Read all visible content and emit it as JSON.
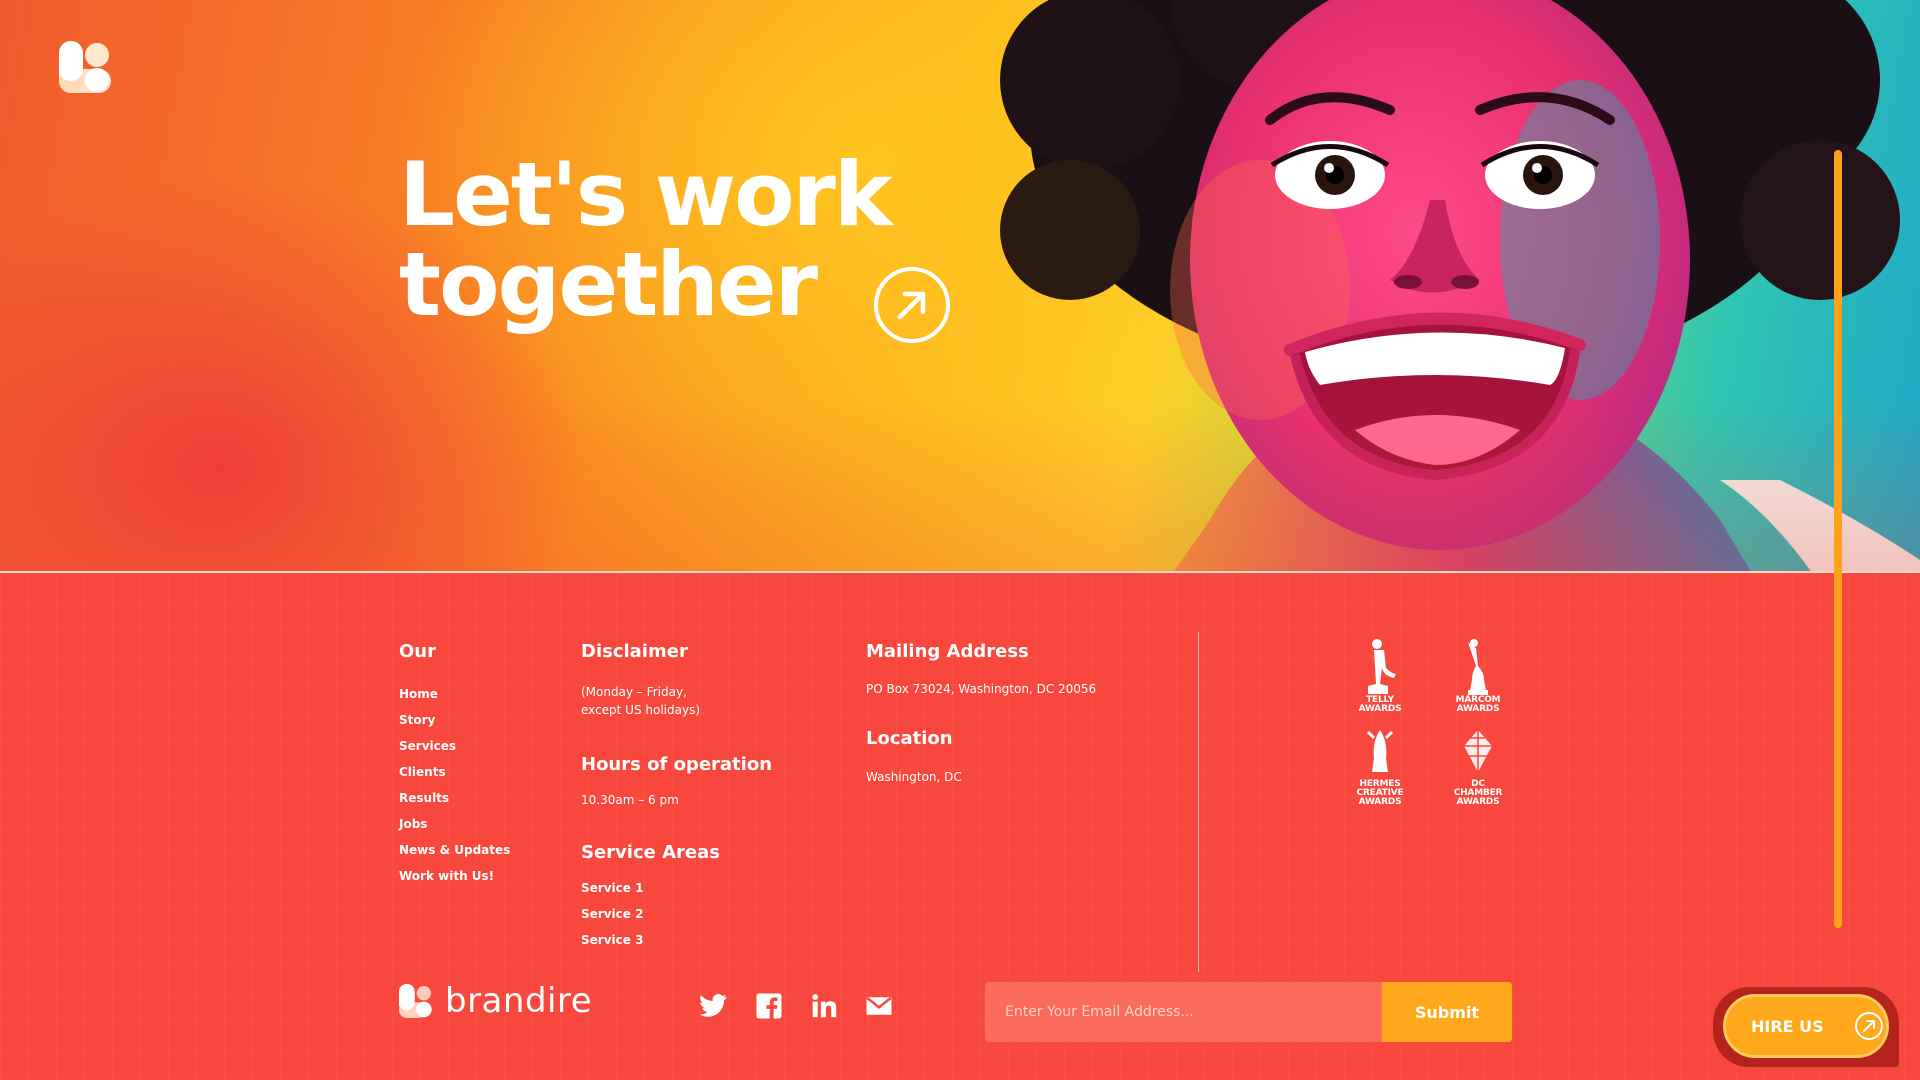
{
  "hero": {
    "title_line1": "Let's work",
    "title_line2": "together",
    "accent_gradient": [
      "#f25a2e",
      "#fdbb1e",
      "#31c6b1"
    ]
  },
  "icons": {
    "logo": "brandire-logo-mark",
    "menu": "hamburger-menu-icon",
    "hero_arrow": "arrow-up-right-circle-icon",
    "social": [
      "twitter-icon",
      "facebook-icon",
      "linkedin-icon",
      "mail-icon"
    ]
  },
  "footer": {
    "our": {
      "title": "Our",
      "links": [
        "Home",
        "Story",
        "Services",
        "Clients",
        "Results",
        "Jobs",
        "News & Updates",
        "Work with Us!"
      ]
    },
    "disclaimer": {
      "title": "Disclaimer",
      "line1": "(Monday – Friday,",
      "line2": "except US holidays)"
    },
    "hours": {
      "title": "Hours of operation",
      "value": "10.30am – 6 pm"
    },
    "service_areas": {
      "title": "Service Areas",
      "items": [
        "Service 1",
        "Service 2",
        "Service 3"
      ]
    },
    "mailing": {
      "title": "Mailing Address",
      "value": "PO Box 73024, Washington, DC 20056"
    },
    "location": {
      "title": "Location",
      "value": "Washington, DC"
    },
    "awards": [
      {
        "l1": "Telly",
        "l2": "Awards",
        "l3": ""
      },
      {
        "l1": "Marcom",
        "l2": "Awards",
        "l3": ""
      },
      {
        "l1": "Hermes",
        "l2": "Creative",
        "l3": "Awards"
      },
      {
        "l1": "DC",
        "l2": "Chamber",
        "l3": "Awards"
      }
    ],
    "brand_name": "brandire",
    "newsletter": {
      "placeholder": "Enter Your Email Address...",
      "submit": "Submit"
    }
  },
  "hire_us": "HIRE US",
  "colors": {
    "footer_bg": "#f8473d",
    "accent_orange": "#ffa81c",
    "scrollbar": "#ffa11a"
  }
}
